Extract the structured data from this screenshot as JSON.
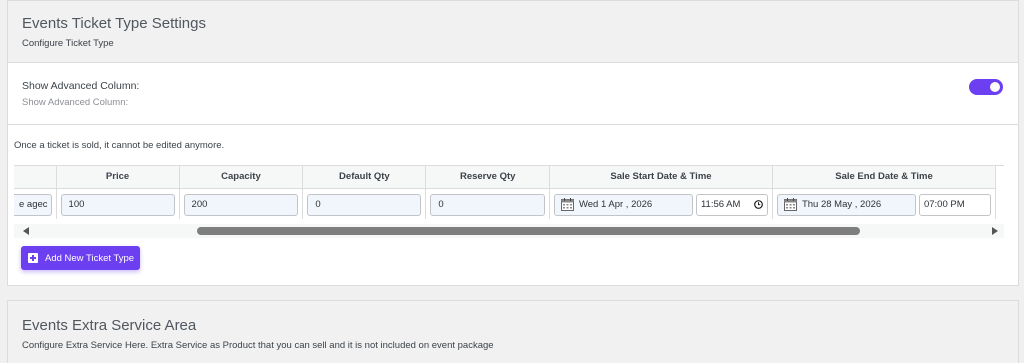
{
  "settings": {
    "title": "Events Ticket Type Settings",
    "subtitle": "Configure Ticket Type",
    "advanced": {
      "label": "Show Advanced Column:",
      "help": "Show Advanced Column:",
      "enabled": true
    },
    "note": "Once a ticket is sold, it cannot be edited anymore.",
    "table": {
      "headers": [
        "Price",
        "Capacity",
        "Default Qty",
        "Reserve Qty",
        "Sale Start Date & Time",
        "Sale End Date & Time"
      ],
      "row": {
        "name_fragment": "e agec",
        "price": "100",
        "capacity": "200",
        "default_qty": "0",
        "reserve_qty": "0",
        "start_date": "Wed 1 Apr , 2026",
        "start_time": "11:56 AM",
        "end_date": "Thu 28 May , 2026",
        "end_time": "07:00 PM"
      }
    },
    "add_button": "Add New Ticket Type"
  },
  "extra": {
    "title": "Events Extra Service Area",
    "subtitle": "Configure Extra Service Here. Extra Service as Product that you can sell and it is not included on event package"
  },
  "colors": {
    "accent": "#6c3ff1",
    "scroll_thumb": "#7e7e7e"
  },
  "icons": [
    "calendar-icon",
    "clock-icon",
    "plus-icon",
    "scroll-left-arrow",
    "scroll-right-arrow"
  ]
}
